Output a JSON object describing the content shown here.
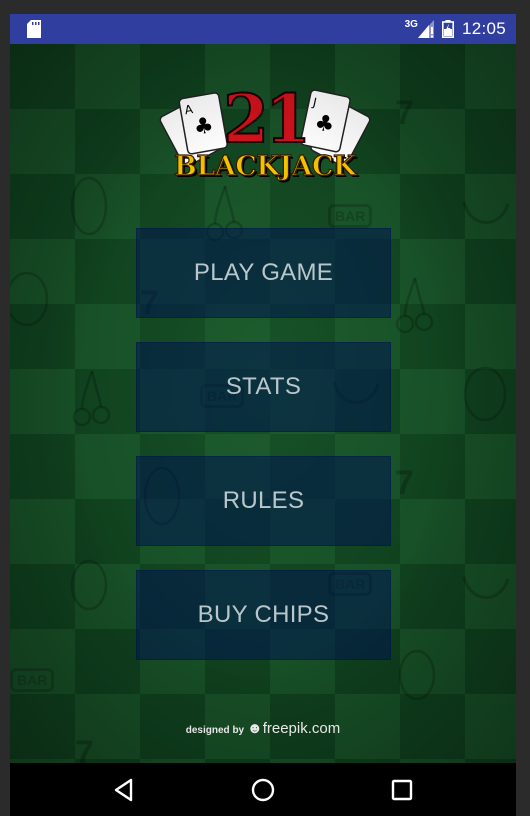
{
  "status_bar": {
    "network": "3G",
    "time": "12:05",
    "icons": [
      "sd-card-icon",
      "signal-icon",
      "battery-icon"
    ]
  },
  "logo": {
    "number": "21",
    "word": "BLACKJACK"
  },
  "menu": {
    "items": [
      {
        "label": "PLAY GAME"
      },
      {
        "label": "STATS"
      },
      {
        "label": "RULES"
      },
      {
        "label": "BUY CHIPS"
      }
    ]
  },
  "credit": {
    "prefix": "designed by",
    "brand": "freepik.com"
  },
  "nav_bar": {
    "icons": [
      "back-icon",
      "home-icon",
      "recents-icon"
    ]
  },
  "colors": {
    "status_bar": "#303f9f",
    "felt_dark": "#0f3f1d",
    "felt_light": "#174e26",
    "button_bg": "#0b1f4e",
    "button_text": "#b9c7cc",
    "logo_red": "#d0121b",
    "logo_gold": "#f2c200"
  }
}
